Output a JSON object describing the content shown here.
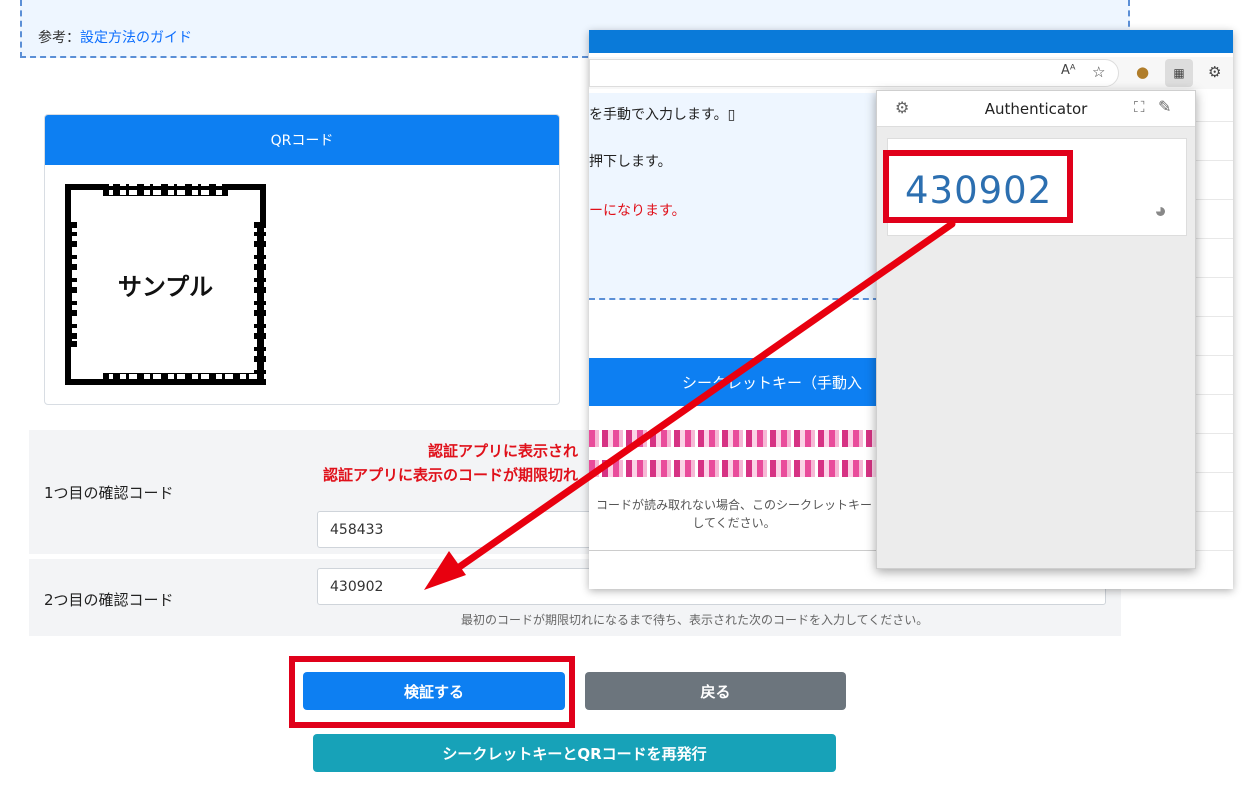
{
  "reference": {
    "prefix": "参考：",
    "link": "設定方法のガイド"
  },
  "qr_card": {
    "title": "QRコード",
    "sample_label": "サンプル"
  },
  "form": {
    "notice_line1": "認証アプリに表示され",
    "notice_line2": "認証アプリに表示のコードが期限切れ",
    "code1_label": "1つ目の確認コード",
    "code1_value": "458433",
    "code2_label": "2つ目の確認コード",
    "code2_value": "430902",
    "hint": "最初のコードが期限切れになるまで待ち、表示された次のコードを入力してください。"
  },
  "buttons": {
    "verify": "検証する",
    "back": "戻る",
    "reissue": "シークレットキーとQRコードを再発行"
  },
  "browser": {
    "toolbar_read_aloud": "Aᴬ",
    "toolbar_qr": "▦",
    "toolbar_ext": "⚙",
    "page_line1": "を手動で入力します。▯",
    "page_line2": "押下します。",
    "page_line3": "ーになります。",
    "secret_header": "シークレットキー（手動入",
    "secret_note_line1": "コードが読み取れない場合、このシークレットキー",
    "secret_note_line2": "してください。"
  },
  "authenticator": {
    "title": "Authenticator",
    "code": "430902"
  },
  "colors": {
    "primary": "#0d7ff2",
    "secondary": "#6c757d",
    "info": "#17a2b8",
    "highlight_red": "#e0001a"
  }
}
